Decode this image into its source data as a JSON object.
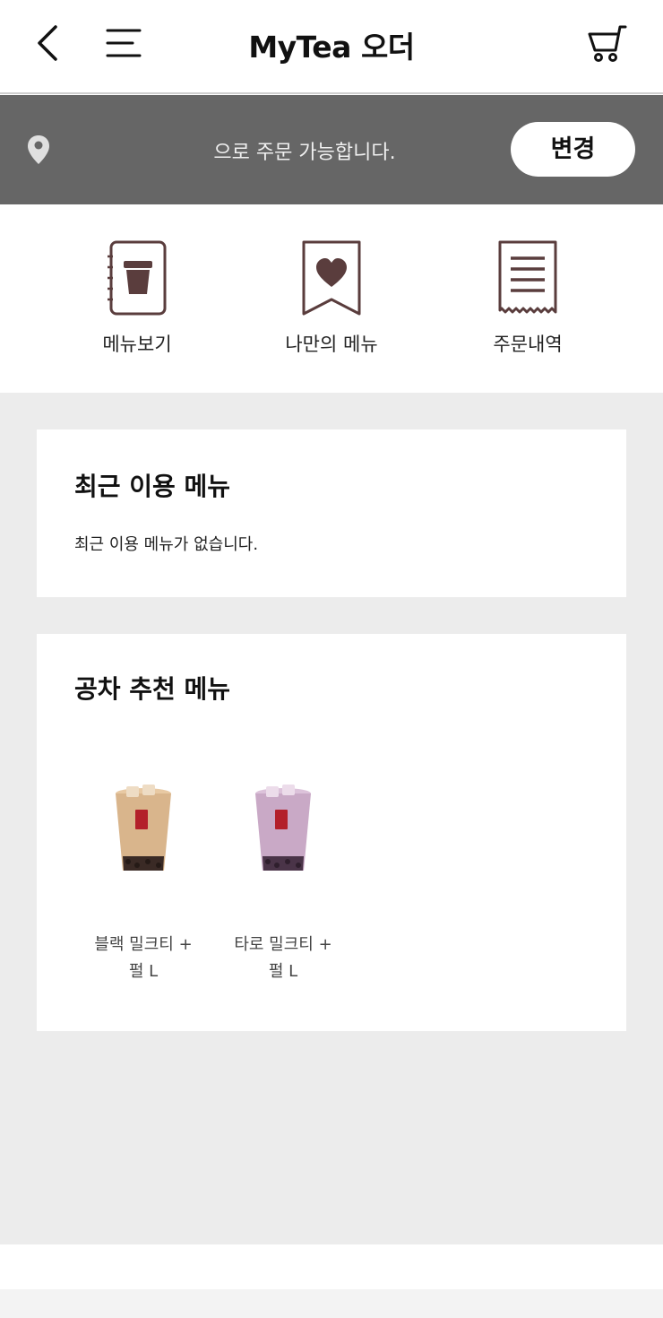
{
  "header": {
    "title": "MyTea 오더",
    "back_icon": "chevron-left-icon",
    "menu_icon": "hamburger-menu-icon",
    "cart_icon": "cart-icon"
  },
  "location": {
    "text": "으로 주문 가능합니다.",
    "change_label": "변경",
    "pin_icon": "location-pin-icon"
  },
  "quick_menu": [
    {
      "label": "메뉴보기",
      "icon": "cup-menu-icon"
    },
    {
      "label": "나만의 메뉴",
      "icon": "heart-bookmark-icon"
    },
    {
      "label": "주문내역",
      "icon": "receipt-icon"
    }
  ],
  "recent": {
    "title": "최근 이용 메뉴",
    "empty_text": "최근 이용 메뉴가 없습니다."
  },
  "recommend": {
    "title": "공차 추천 메뉴",
    "items": [
      {
        "name_line1": "블랙 밀크티 +",
        "name_line2": "펄 L",
        "color": "#d9b58c"
      },
      {
        "name_line1": "타로 밀크티 +",
        "name_line2": "펄 L",
        "color": "#c9a9c6"
      }
    ]
  },
  "colors": {
    "brand_brown": "#5a3d3d",
    "location_bar": "#666666",
    "background_gray": "#ececec"
  }
}
